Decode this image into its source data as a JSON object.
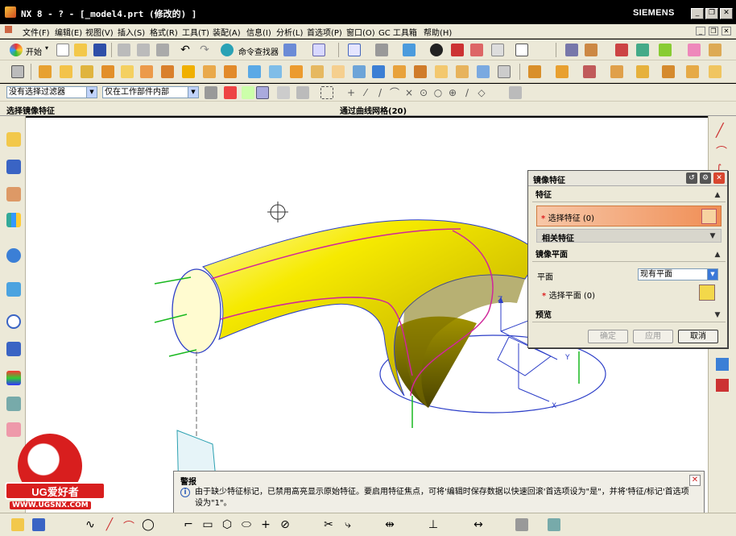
{
  "window": {
    "title": "NX 8 - ? - [_model4.prt (修改的) ]",
    "brand": "SIEMENS"
  },
  "menu": {
    "items": [
      "文件(F)",
      "编辑(E)",
      "视图(V)",
      "插入(S)",
      "格式(R)",
      "工具(T)",
      "装配(A)",
      "信息(I)",
      "分析(L)",
      "首选项(P)",
      "窗口(O)",
      "GC 工具箱",
      "帮助(H)"
    ]
  },
  "toolbar": {
    "start_label": "开始",
    "command_finder_label": "命令查找器"
  },
  "filters": {
    "type_filter": "没有选择过滤器",
    "scope_filter": "仅在工作部件内部"
  },
  "cue": {
    "left": "选择镜像特征",
    "center": "通过曲线网格(20)"
  },
  "dialog": {
    "title": "镜像特征",
    "group_feature": "特征",
    "select_feature": "选择特征 (0)",
    "related_feature": "相关特征",
    "group_plane": "镜像平面",
    "plane_label": "平面",
    "plane_value": "现有平面",
    "select_plane": "选择平面 (0)",
    "group_preview": "预览",
    "ok": "确定",
    "apply": "应用",
    "cancel": "取消"
  },
  "alert": {
    "heading": "警报",
    "message": "由于缺少特征标记，已禁用高亮显示原始特征。要启用特征焦点，可将'编辑时保存数据以快速回滚'首选项设为\"是\"，并将'特征/标记'首选项设为\"1\"。"
  },
  "axes": {
    "z": "Z",
    "y": "Y",
    "x": "X"
  },
  "watermark": {
    "text": "UG爱好者",
    "url": "WWW.UGSNX.COM"
  },
  "colors": {
    "surface": "#f2e600",
    "edge": "#d0279a",
    "wire": "#2c3ec8",
    "green": "#19b81f",
    "accent": "#f0a070"
  }
}
